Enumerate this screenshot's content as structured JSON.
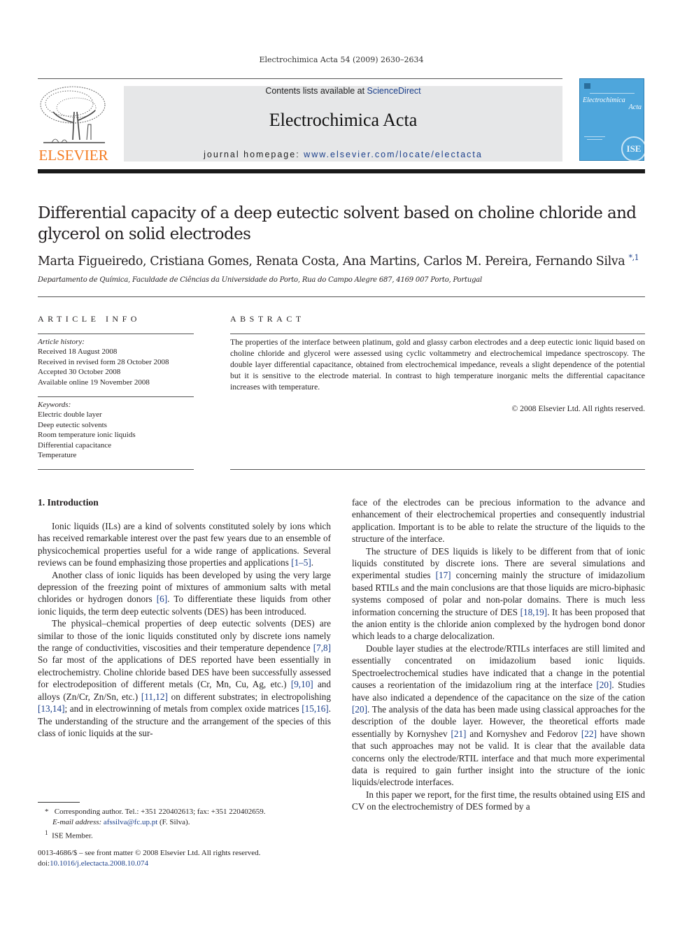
{
  "header": {
    "running_head": "Electrochimica Acta 54 (2009) 2630–2634",
    "contents_prefix": "Contents lists available at ",
    "contents_link": "ScienceDirect",
    "journal_title": "Electrochimica Acta",
    "homepage_prefix": "journal homepage: ",
    "homepage_link": "www.elsevier.com/locate/electacta",
    "publisher_logo_text": "ELSEVIER",
    "cover_title_line1": "Electrochimica",
    "cover_title_line2": "Acta",
    "cover_seal": "ISE"
  },
  "colors": {
    "publisher_orange": "#f47b20",
    "link_blue": "#1b3f8b",
    "cover_blue": "#4ea6dc",
    "masthead_gray": "#e6e7e8"
  },
  "article": {
    "title": "Differential capacity of a deep eutectic solvent based on choline chloride and glycerol on solid electrodes",
    "authors": "Marta Figueiredo, Cristiana Gomes, Renata Costa, Ana Martins, Carlos M. Pereira, Fernando Silva",
    "author_marks": "*,1",
    "affiliation": "Departamento de Química, Faculdade de Ciências da Universidade do Porto, Rua do Campo Alegre 687, 4169 007 Porto, Portugal"
  },
  "article_info": {
    "heading": "ARTICLE INFO",
    "history_label": "Article history:",
    "history": [
      "Received 18 August 2008",
      "Received in revised form 28 October 2008",
      "Accepted 30 October 2008",
      "Available online 19 November 2008"
    ],
    "keywords_label": "Keywords:",
    "keywords": [
      "Electric double layer",
      "Deep eutectic solvents",
      "Room temperature ionic liquids",
      "Differential capacitance",
      "Temperature"
    ]
  },
  "abstract": {
    "heading": "ABSTRACT",
    "text": "The properties of the interface between platinum, gold and glassy carbon electrodes and a deep eutectic ionic liquid based on choline chloride and glycerol were assessed using cyclic voltammetry and electrochemical impedance spectroscopy. The double layer differential capacitance, obtained from electrochemical impedance, reveals a slight dependence of the potential but it is sensitive to the electrode material. In contrast to high temperature inorganic melts the differential capacitance increases with temperature.",
    "copyright": "© 2008 Elsevier Ltd. All rights reserved."
  },
  "body": {
    "section_title": "1.  Introduction",
    "left": [
      {
        "segments": [
          {
            "t": "Ionic liquids (ILs) are a kind of solvents constituted solely by ions which has received remarkable interest over the past few years due to an ensemble of physicochemical properties useful for a wide range of applications. Several reviews can be found emphasizing those properties and applications "
          },
          {
            "t": "[1–5]",
            "ref": true
          },
          {
            "t": "."
          }
        ]
      },
      {
        "segments": [
          {
            "t": "Another class of ionic liquids has been developed by using the very large depression of the freezing point of mixtures of ammonium salts with metal chlorides or hydrogen donors "
          },
          {
            "t": "[6]",
            "ref": true
          },
          {
            "t": ". To differentiate these liquids from other ionic liquids, the term deep eutectic solvents (DES) has been introduced."
          }
        ]
      },
      {
        "segments": [
          {
            "t": "The physical–chemical properties of deep eutectic solvents (DES) are similar to those of the ionic liquids constituted only by discrete ions namely the range of conductivities, viscosities and their temperature dependence "
          },
          {
            "t": "[7,8]",
            "ref": true
          },
          {
            "t": " So far most of the applications of DES reported have been essentially in electrochemistry. Choline chloride based DES have been successfully assessed for electrodeposition of different metals (Cr, Mn, Cu, Ag, etc.) "
          },
          {
            "t": "[9,10]",
            "ref": true
          },
          {
            "t": " and alloys (Zn/Cr, Zn/Sn, etc.) "
          },
          {
            "t": "[11,12]",
            "ref": true
          },
          {
            "t": " on different substrates; in electropolishing "
          },
          {
            "t": "[13,14]",
            "ref": true
          },
          {
            "t": "; and in electrowinning of metals from complex oxide matrices "
          },
          {
            "t": "[15,16]",
            "ref": true
          },
          {
            "t": ". The understanding of the structure and the arrangement of the species of this class of ionic liquids at the sur-"
          }
        ]
      }
    ],
    "right": [
      {
        "noindent": true,
        "segments": [
          {
            "t": "face of the electrodes can be precious information to the advance and enhancement of their electrochemical properties and consequently industrial application. Important is to be able to relate the structure of the liquids to the structure of the interface."
          }
        ]
      },
      {
        "segments": [
          {
            "t": "The structure of DES liquids is likely to be different from that of ionic liquids constituted by discrete ions. There are several simulations and experimental studies "
          },
          {
            "t": "[17]",
            "ref": true
          },
          {
            "t": " concerning mainly the structure of imidazolium based RTILs and the main conclusions are that those liquids are micro-biphasic systems composed of polar and non-polar domains. There is much less information concerning the structure of DES "
          },
          {
            "t": "[18,19]",
            "ref": true
          },
          {
            "t": ". It has been proposed that the anion entity is the chloride anion complexed by the hydrogen bond donor which leads to a charge delocalization."
          }
        ]
      },
      {
        "segments": [
          {
            "t": "Double layer studies at the electrode/RTILs interfaces are still limited and essentially concentrated on imidazolium based ionic liquids. Spectroelectrochemical studies have indicated that a change in the potential causes a reorientation of the imidazolium ring at the interface "
          },
          {
            "t": "[20]",
            "ref": true
          },
          {
            "t": ". Studies have also indicated a dependence of the capacitance on the size of the cation "
          },
          {
            "t": "[20]",
            "ref": true
          },
          {
            "t": ". The analysis of the data has been made using classical approaches for the description of the double layer. However, the theoretical efforts made essentially by Kornyshev "
          },
          {
            "t": "[21]",
            "ref": true
          },
          {
            "t": " and Kornyshev and Fedorov "
          },
          {
            "t": "[22]",
            "ref": true
          },
          {
            "t": " have shown that such approaches may not be valid. It is clear that the available data concerns only the electrode/RTIL interface and that much more experimental data is required to gain further insight into the structure of the ionic liquids/electrode interfaces."
          }
        ]
      },
      {
        "segments": [
          {
            "t": "In this paper we report, for the first time, the results obtained using EIS and CV on the electrochemistry of DES formed by a"
          }
        ]
      }
    ]
  },
  "footnotes": {
    "corresponding_mark": "*",
    "corresponding": "Corresponding author. Tel.: +351 220402613; fax: +351 220402659.",
    "email_label": "E-mail address: ",
    "email": "afssilva@fc.up.pt",
    "email_suffix": " (F. Silva).",
    "member_mark": "1",
    "member": "ISE Member."
  },
  "imprint": {
    "issn_line": "0013-4686/$ – see front matter © 2008 Elsevier Ltd. All rights reserved.",
    "doi_prefix": "doi:",
    "doi": "10.1016/j.electacta.2008.10.074"
  }
}
